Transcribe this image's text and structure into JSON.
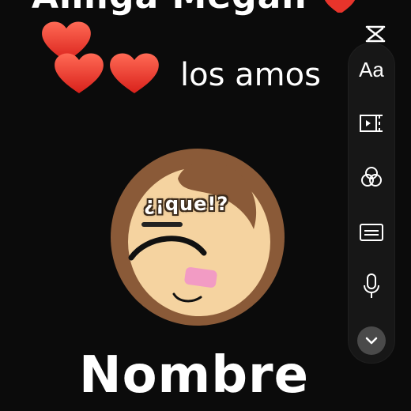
{
  "video": {
    "top_caption": "Amiga Megan",
    "second_caption": "los amos",
    "avatar_caption": "¿¡que!?",
    "bottom_caption": "Nombre"
  },
  "toolbar": {
    "close_icon": "close-icon",
    "text_tool_label": "Aa",
    "tools": [
      "text-tool",
      "split-clip-icon",
      "filters-icon",
      "captions-icon",
      "microphone-icon",
      "chevron-down-icon"
    ]
  },
  "colors": {
    "background": "#0b0b0b",
    "heart": "#e8342b",
    "skin": "#f5d3a0",
    "hair": "#8a5a38",
    "blush": "#f29bc4",
    "toolbar": "#191919"
  }
}
